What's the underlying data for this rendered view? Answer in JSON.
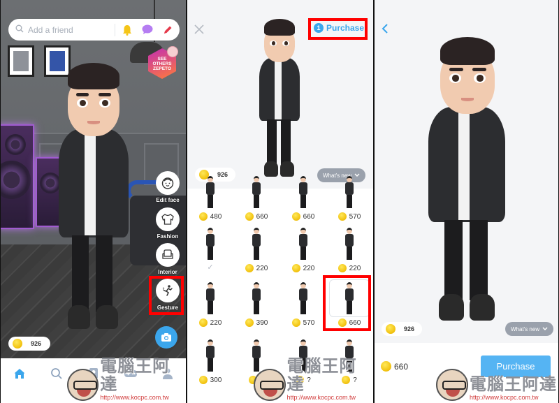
{
  "panel1": {
    "search_placeholder": "Add a friend",
    "icons": [
      "search-icon",
      "bell-icon",
      "chat-bubble-icon",
      "pencil-icon"
    ],
    "see_others": [
      "SEE",
      "OTHERS",
      "ZEPETO"
    ],
    "side_buttons": [
      {
        "label": "Edit face",
        "icon": "face-icon"
      },
      {
        "label": "Fashion",
        "icon": "shirt-icon"
      },
      {
        "label": "Interior",
        "icon": "armchair-icon"
      },
      {
        "label": "Gesture",
        "icon": "gesture-icon"
      }
    ],
    "coins": "926",
    "tabs": [
      "home-icon",
      "search-icon",
      "profile-card-icon",
      "game-controller-icon",
      "person-icon"
    ],
    "colors": {
      "accent": "#3ba6ec",
      "bell": "#f5c518",
      "chat": "#b57df2",
      "pencil": "#e5384a",
      "highlight": "#ff0000"
    }
  },
  "panel2": {
    "purchase_count": "1",
    "purchase_label": "Purchase",
    "coins": "926",
    "whats_new": "What's new",
    "grid": [
      {
        "price": "480"
      },
      {
        "price": "660"
      },
      {
        "price": "660"
      },
      {
        "price": "570"
      },
      {
        "owned": true,
        "check": "✓"
      },
      {
        "price": "220"
      },
      {
        "price": "220"
      },
      {
        "price": "220"
      },
      {
        "price": "220"
      },
      {
        "price": "390"
      },
      {
        "price": "570"
      },
      {
        "price": "660",
        "selected": true
      },
      {
        "price": "300"
      },
      {
        "price": "?"
      },
      {
        "price": "?"
      },
      {
        "price": "?"
      }
    ]
  },
  "panel3": {
    "coins": "926",
    "whats_new": "What's new",
    "price": "660",
    "purchase_button": "Purchase"
  },
  "watermark": {
    "title": "電腦王阿達",
    "url": "http://www.kocpc.com.tw"
  }
}
